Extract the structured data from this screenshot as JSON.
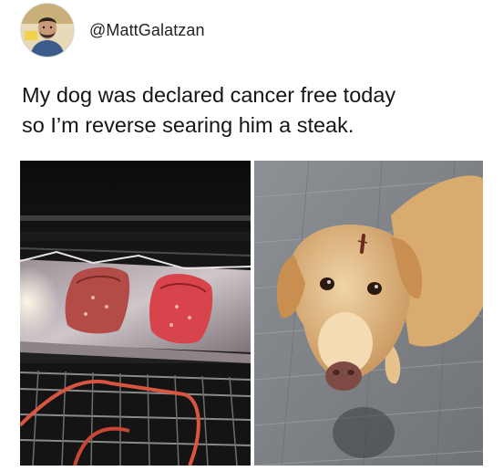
{
  "post": {
    "author_handle": "@MattGalatzan",
    "text_lines": [
      "My dog was declared cancer free today",
      "so I’m reverse searing him a steak."
    ]
  },
  "images": [
    {
      "subject": "steaks-in-oven"
    },
    {
      "subject": "golden-retriever-looking-up"
    }
  ],
  "colors": {
    "text": "#151515",
    "handle": "#222222",
    "background": "#ffffff"
  }
}
